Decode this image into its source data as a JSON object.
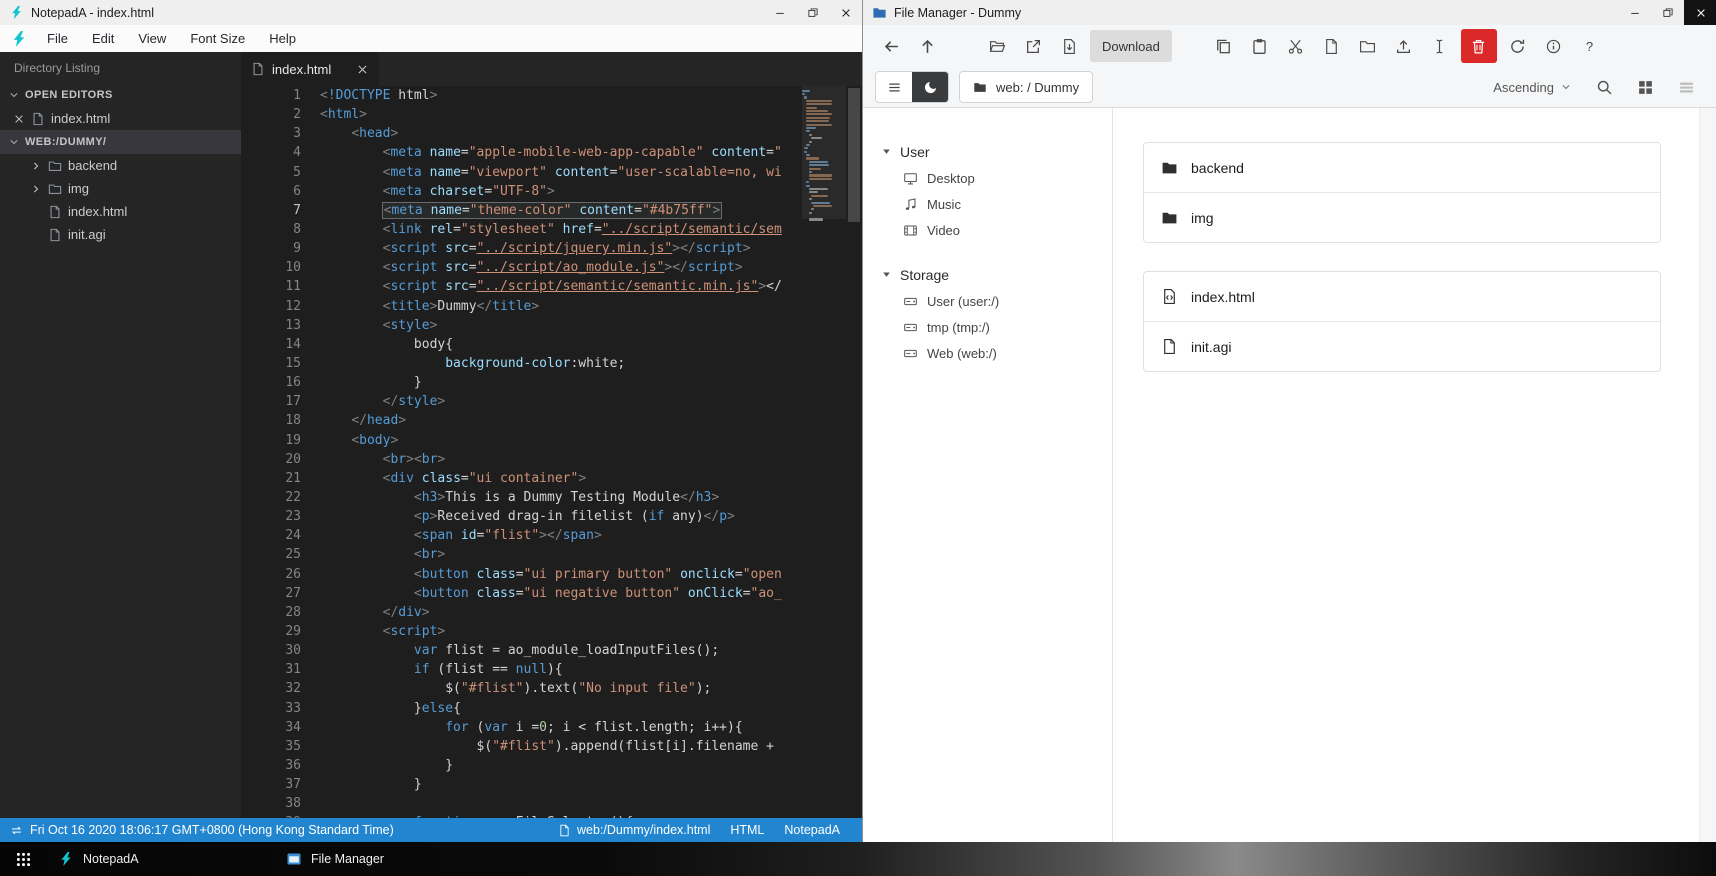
{
  "notepad": {
    "window_title": "NotepadA - index.html",
    "menu_items": [
      "File",
      "Edit",
      "View",
      "Font Size",
      "Help"
    ],
    "explorer": {
      "header": "Directory Listing",
      "open_editors_label": "OPEN EDITORS",
      "open_editors": [
        {
          "name": "index.html"
        }
      ],
      "workspace_label": "WEB:/DUMMY/",
      "items": [
        {
          "name": "backend",
          "kind": "folder"
        },
        {
          "name": "img",
          "kind": "folder"
        },
        {
          "name": "index.html",
          "kind": "file"
        },
        {
          "name": "init.agi",
          "kind": "file"
        }
      ]
    },
    "tabs": [
      {
        "label": "index.html",
        "active": true
      }
    ],
    "editor": {
      "active_line": 7,
      "lines": [
        "<!DOCTYPE html>",
        "<html>",
        "    <head>",
        "        <meta name=\"apple-mobile-web-app-capable\" content=\"",
        "        <meta name=\"viewport\" content=\"user-scalable=no, wi",
        "        <meta charset=\"UTF-8\">",
        "        <meta name=\"theme-color\" content=\"#4b75ff\">",
        "        <link rel=\"stylesheet\" href=\"../script/semantic/sem",
        "        <script src=\"../script/jquery.min.js\"></script>",
        "        <script src=\"../script/ao_module.js\"></script>",
        "        <script src=\"../script/semantic/semantic.min.js\"></",
        "        <title>Dummy</title>",
        "        <style>",
        "            body{",
        "                background-color:white;",
        "            }",
        "        </style>",
        "    </head>",
        "    <body>",
        "        <br><br>",
        "        <div class=\"ui container\">",
        "            <h3>This is a Dummy Testing Module</h3>",
        "            <p>Received drag-in filelist (if any)</p>",
        "            <span id=\"flist\"></span>",
        "            <br>",
        "            <button class=\"ui primary button\" onclick=\"open",
        "            <button class=\"ui negative button\" onClick=\"ao_",
        "        </div>",
        "        <script>",
        "            var flist = ao_module_loadInputFiles();",
        "            if (flist == null){",
        "                $(\"#flist\").text(\"No input file\");",
        "            }else{",
        "                for (var i =0; i < flist.length; i++){",
        "                    $(\"#flist\").append(flist[i].filename + ",
        "                }",
        "            }",
        "",
        "            function openFileSelector(){"
      ]
    },
    "status_bar": {
      "datetime": "Fri Oct 16 2020 18:06:17 GMT+0800 (Hong Kong Standard Time)",
      "file_path": "web:/Dummy/index.html",
      "language": "HTML",
      "app_name": "NotepadA"
    }
  },
  "file_manager": {
    "window_title": "File Manager - Dummy",
    "toolbar": {
      "download_label": "Download"
    },
    "pathbar": {
      "location": "web: / Dummy",
      "sort_label": "Ascending"
    },
    "sidebar": {
      "sections": [
        {
          "label": "User",
          "items": [
            {
              "label": "Desktop",
              "icon": "desktop-icon"
            },
            {
              "label": "Music",
              "icon": "music-icon"
            },
            {
              "label": "Video",
              "icon": "video-icon"
            }
          ]
        },
        {
          "label": "Storage",
          "items": [
            {
              "label": "User (user:/)",
              "icon": "drive-icon"
            },
            {
              "label": "tmp (tmp:/)",
              "icon": "drive-icon"
            },
            {
              "label": "Web (web:/)",
              "icon": "drive-icon"
            }
          ]
        }
      ]
    },
    "file_groups": [
      {
        "items": [
          {
            "name": "backend",
            "icon": "folder-icon"
          },
          {
            "name": "img",
            "icon": "folder-icon"
          }
        ]
      },
      {
        "items": [
          {
            "name": "index.html",
            "icon": "file-code-icon"
          },
          {
            "name": "init.agi",
            "icon": "file-icon"
          }
        ]
      }
    ]
  },
  "taskbar": {
    "items": [
      {
        "label": "NotepadA",
        "icon": "notepada-logo-icon"
      },
      {
        "label": "File Manager",
        "icon": "file-manager-logo-icon"
      }
    ]
  },
  "icons": {
    "notepada-logo-icon": "cyan lightning bolt",
    "file-manager-logo-icon": "blue window",
    "search-icon": "magnifier",
    "moon-icon": "dark mode crescent",
    "trash-icon": "delete can on red button",
    "grid-view-icon": "four squares",
    "list-view-icon": "three bars"
  },
  "colors": {
    "status_bar_blue": "#2185d0",
    "danger_red": "#db2828",
    "logo_cyan": "#13c4cd",
    "editor_background": "#1e1e1e"
  }
}
